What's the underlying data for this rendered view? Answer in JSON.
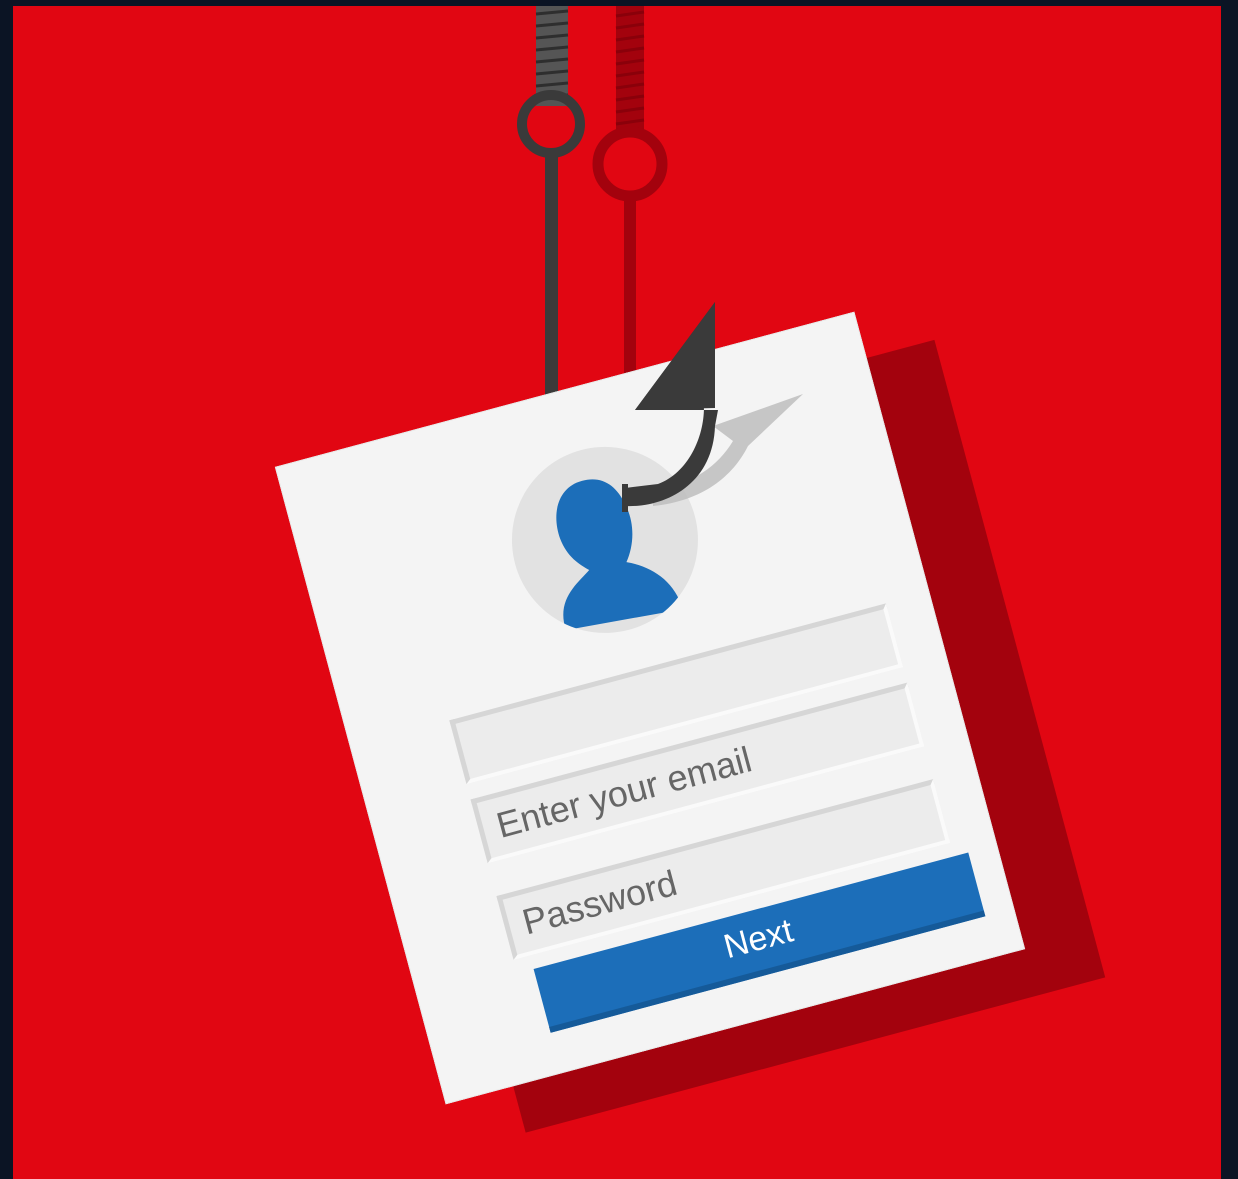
{
  "login": {
    "email_placeholder": "Enter your email",
    "password_placeholder": "Password",
    "next_label": "Next"
  },
  "icons": {
    "hook": "fishing-hook-icon",
    "avatar": "user-avatar-icon"
  },
  "colors": {
    "background": "#e10612",
    "frame": "#0b1424",
    "card": "#f4f4f4",
    "card_shadow": "#a3020d",
    "accent": "#1c6eb9",
    "hook": "#3a3a3a"
  }
}
